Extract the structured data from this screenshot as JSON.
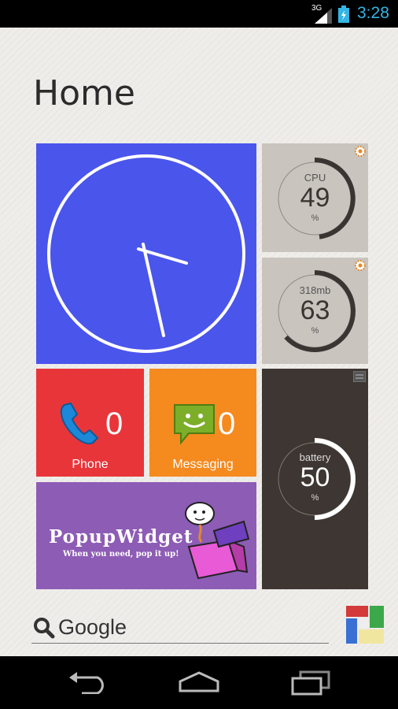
{
  "status_bar": {
    "network": "3G",
    "time": "3:28",
    "accent_color": "#33b5e5"
  },
  "home": {
    "title": "Home"
  },
  "tiles": {
    "clock": {
      "color": "#4a55ec"
    },
    "cpu": {
      "label": "CPU",
      "value": "49",
      "unit": "%",
      "percent": 49,
      "color": "#c9c4be"
    },
    "memory": {
      "label": "318mb",
      "value": "63",
      "unit": "%",
      "percent": 63,
      "color": "#c9c4be"
    },
    "phone": {
      "label": "Phone",
      "count": "0",
      "icon": "phone-handset-icon",
      "color": "#e8353a"
    },
    "messaging": {
      "label": "Messaging",
      "count": "0",
      "icon": "smiley-message-icon",
      "color": "#f58a1f"
    },
    "battery": {
      "label": "battery",
      "value": "50",
      "unit": "%",
      "percent": 50,
      "color": "#3d3632"
    },
    "promo": {
      "title": "PopupWidget",
      "tagline": "When you need, pop it up!",
      "color": "#8d5cb5"
    }
  },
  "search": {
    "label": "Google",
    "icon": "search-icon"
  },
  "nav": {
    "back_icon": "back-icon",
    "home_icon": "home-icon",
    "recents_icon": "recents-icon"
  }
}
